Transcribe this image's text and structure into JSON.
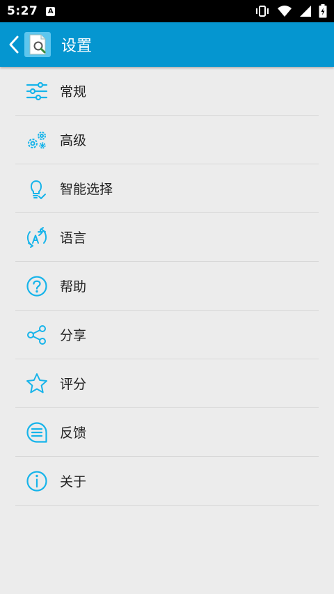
{
  "status_bar": {
    "time": "5:27",
    "notification_badge": "A"
  },
  "app_bar": {
    "title": "设置",
    "back_icon": "chevron-left-icon",
    "logo_icon": "document-search-icon"
  },
  "colors": {
    "accent": "#0596d0",
    "icon": "#17b4ea",
    "background": "#ececec"
  },
  "settings": {
    "items": [
      {
        "label": "常规",
        "icon": "sliders-icon"
      },
      {
        "label": "高级",
        "icon": "gears-icon"
      },
      {
        "label": "智能选择",
        "icon": "lightbulb-icon"
      },
      {
        "label": "语言",
        "icon": "translate-icon"
      },
      {
        "label": "帮助",
        "icon": "help-icon"
      },
      {
        "label": "分享",
        "icon": "share-icon"
      },
      {
        "label": "评分",
        "icon": "star-icon"
      },
      {
        "label": "反馈",
        "icon": "feedback-icon"
      },
      {
        "label": "关于",
        "icon": "info-icon"
      }
    ]
  }
}
